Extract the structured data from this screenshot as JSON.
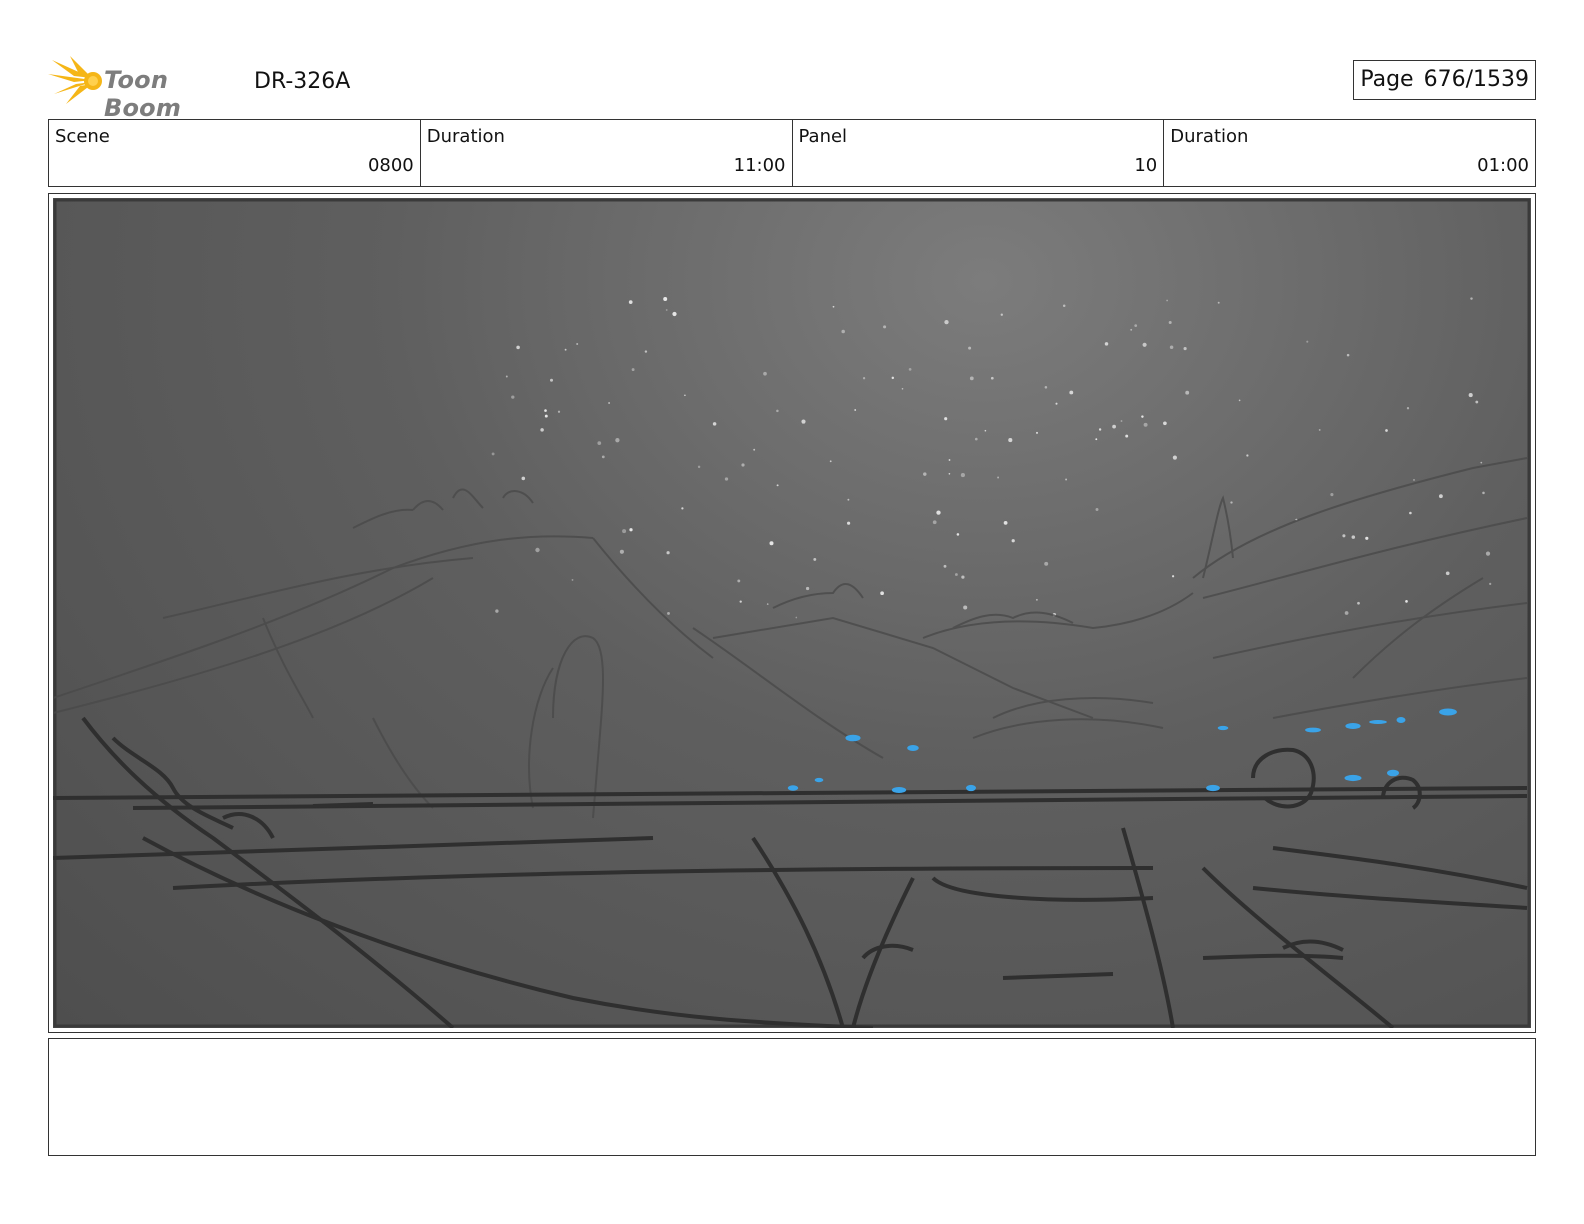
{
  "header": {
    "logo_text": "Toon Boom",
    "doc_id": "DR-326A",
    "page_label": "Page",
    "page_value": "676/1539",
    "logo_colors": {
      "burst": "#f5b617",
      "text": "#7d7d7d"
    }
  },
  "info": {
    "scene_label": "Scene",
    "scene_value": "0800",
    "duration_label": "Duration",
    "duration_value": "11:00",
    "panel_label": "Panel",
    "panel_value": "10",
    "panel_duration_label": "Duration",
    "panel_duration_value": "01:00"
  },
  "panel_image": {
    "icon": "night-valley-sketch",
    "accent_color": "#3aa3e8"
  },
  "notes": {
    "text": ""
  }
}
